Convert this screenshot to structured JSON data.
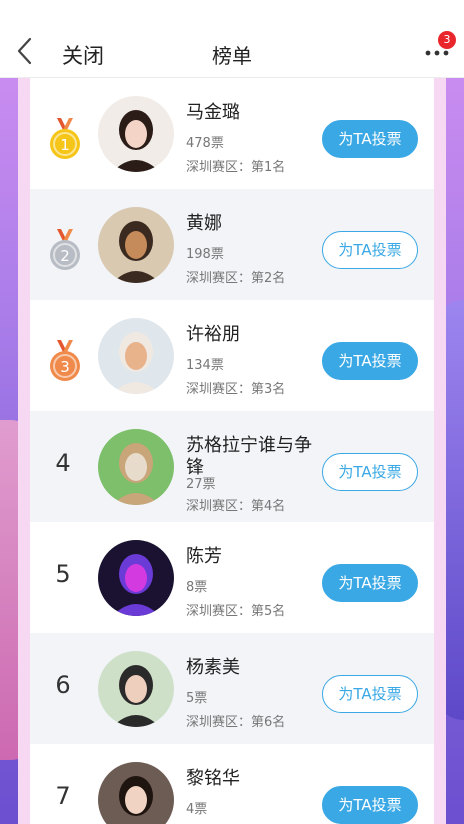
{
  "header": {
    "close_label": "关闭",
    "title": "榜单",
    "badge_count": "3"
  },
  "colors": {
    "accent": "#3aa8e4",
    "badge": "#e8262b",
    "gold": "#f5c518",
    "silver": "#b8bcc4",
    "bronze": "#f08a4b"
  },
  "vote_label": "为TA投票",
  "entries": [
    {
      "rank": "1",
      "medal": "gold",
      "name": "马金璐",
      "votes": "478票",
      "region": "深圳赛区：第1名",
      "button_style": "filled"
    },
    {
      "rank": "2",
      "medal": "silver",
      "name": "黄娜",
      "votes": "198票",
      "region": "深圳赛区：第2名",
      "button_style": "outline"
    },
    {
      "rank": "3",
      "medal": "bronze",
      "name": "许裕朋",
      "votes": "134票",
      "region": "深圳赛区：第3名",
      "button_style": "filled"
    },
    {
      "rank": "4",
      "medal": "",
      "name": "苏格拉宁谁与争锋",
      "votes": "27票",
      "region": "深圳赛区：第4名",
      "button_style": "outline"
    },
    {
      "rank": "5",
      "medal": "",
      "name": "陈芳",
      "votes": "8票",
      "region": "深圳赛区：第5名",
      "button_style": "filled"
    },
    {
      "rank": "6",
      "medal": "",
      "name": "杨素美",
      "votes": "5票",
      "region": "深圳赛区：第6名",
      "button_style": "outline"
    },
    {
      "rank": "7",
      "medal": "",
      "name": "黎铭华",
      "votes": "4票",
      "region": "",
      "button_style": "filled"
    }
  ]
}
